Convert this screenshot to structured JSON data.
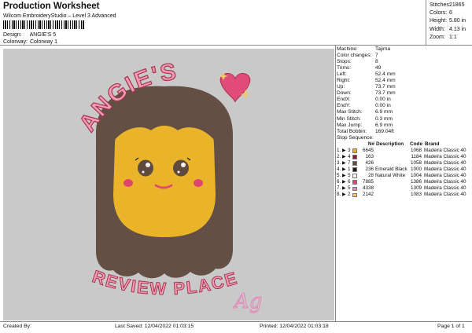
{
  "header": {
    "title": "Production Worksheet",
    "subtitle": "Wilcom EmbroideryStudio – Level 3 Advanced",
    "design_label": "Design:",
    "design_value": "ANGIE'S 5",
    "colorway_label": "Colorway:",
    "colorway_value": "Colorway 1"
  },
  "top_stats": [
    {
      "label": "Stitches:",
      "value": "21865"
    },
    {
      "label": "Colors:",
      "value": "6"
    },
    {
      "label": "Height:",
      "value": "5.80 in"
    },
    {
      "label": "Width:",
      "value": "4.13 in"
    },
    {
      "label": "Zoom:",
      "value": "1:1"
    }
  ],
  "machine_stats": [
    {
      "label": "Machine:",
      "value": "Tajima"
    },
    {
      "label": "Color changes:",
      "value": "7"
    },
    {
      "label": "Stops:",
      "value": "8"
    },
    {
      "label": "Trims:",
      "value": "49"
    },
    {
      "label": "Left:",
      "value": "52.4 mm"
    },
    {
      "label": "Right:",
      "value": "52.4 mm"
    },
    {
      "label": "Up:",
      "value": "73.7 mm"
    },
    {
      "label": "Down:",
      "value": "73.7 mm"
    },
    {
      "label": "EndX:",
      "value": "0.00 in"
    },
    {
      "label": "EndY:",
      "value": "0.00 in"
    },
    {
      "label": "Max Stitch:",
      "value": "6.9 mm"
    },
    {
      "label": "Min Stitch:",
      "value": "0.3 mm"
    },
    {
      "label": "Max Jump:",
      "value": "6.9 mm"
    },
    {
      "label": "Total Bobbin:",
      "value": "169.04ft"
    }
  ],
  "stop_sequence": {
    "title": "Stop Sequence:",
    "headers": {
      "n": "N#",
      "desc": "Description",
      "code": "Code",
      "brand": "Brand"
    },
    "rows": [
      {
        "idx": "1.",
        "stop": "3",
        "color": "#e8b024",
        "num": "6645",
        "desc": "",
        "code": "1068",
        "brand": "Madeira Classic 40"
      },
      {
        "idx": "2.",
        "stop": "4",
        "color": "#8a1d3e",
        "num": "163",
        "desc": "",
        "code": "1184",
        "brand": "Madeira Classic 40"
      },
      {
        "idx": "3.",
        "stop": "7",
        "color": "#5e4a3e",
        "num": "426",
        "desc": "",
        "code": "1058",
        "brand": "Madeira Classic 40"
      },
      {
        "idx": "4.",
        "stop": "1",
        "color": "#1a1a1a",
        "num": "236",
        "desc": "Emerald Black",
        "code": "1000",
        "brand": "Madeira Classic 40"
      },
      {
        "idx": "5.",
        "stop": "5",
        "color": "#f6f4ee",
        "num": "28",
        "desc": "Natural White",
        "code": "1004",
        "brand": "Madeira Classic 40"
      },
      {
        "idx": "6.",
        "stop": "6",
        "color": "#e0456e",
        "num": "7885",
        "desc": "",
        "code": "1386",
        "brand": "Madeira Classic 40"
      },
      {
        "idx": "7.",
        "stop": "5",
        "color": "#e585b8",
        "num": "4338",
        "desc": "",
        "code": "1309",
        "brand": "Madeira Classic 40"
      },
      {
        "idx": "8.",
        "stop": "2",
        "color": "#f2c86e",
        "num": "2142",
        "desc": "",
        "code": "1083",
        "brand": "Madeira Classic 40"
      }
    ]
  },
  "artwork": {
    "top_text": "ANGIE'S",
    "bottom_text": "REVIEW PLACE",
    "signature": "Ag",
    "colors": {
      "background": "#c9c9c9",
      "hair": "#5e4a3e",
      "face": "#e8b024",
      "letters": "#f19cb6",
      "letter_outline": "#a8334d",
      "heart": "#e04b7a",
      "star": "#f2c86e",
      "cheek": "#e0456e",
      "eye_white": "#f6f4ee"
    }
  },
  "footer": {
    "created_by": "Created By:",
    "last_saved": "Last Saved: 12/04/2022 01:03:15",
    "printed": "Printed: 12/04/2022 01:03:18",
    "page": "Page 1 of 1"
  }
}
